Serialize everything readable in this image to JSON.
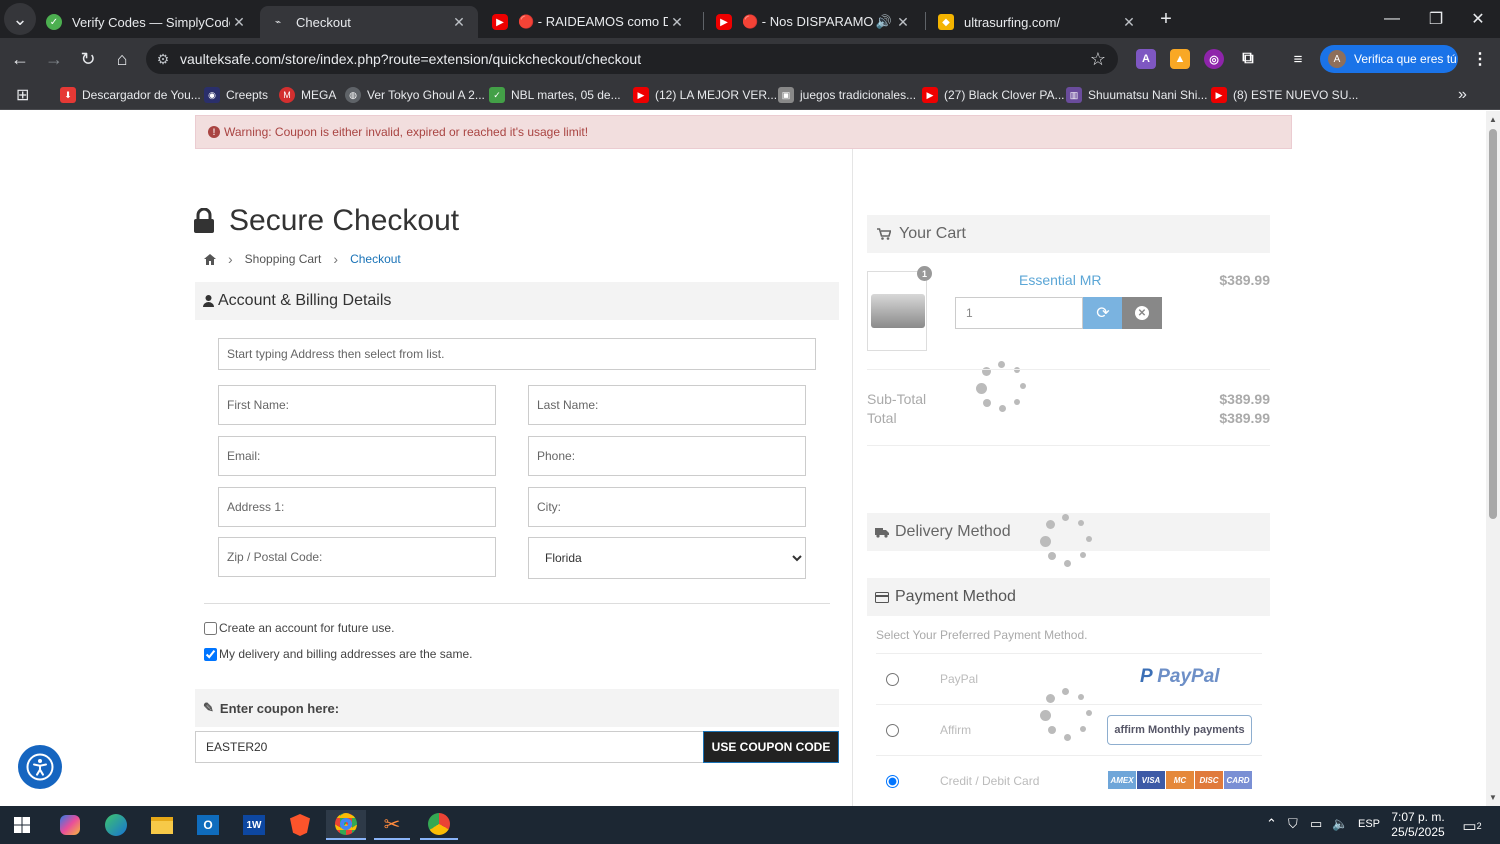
{
  "browser": {
    "tabs": [
      {
        "title": "Verify Codes — SimplyCodes",
        "favicon": "simplycodes-icon",
        "active": false
      },
      {
        "title": "Checkout",
        "favicon": "checkout-icon",
        "active": true
      },
      {
        "title": "🔴 - RAIDEAMOS como DIOSES",
        "favicon": "youtube-icon",
        "active": false
      },
      {
        "title": "🔴 - Nos DISPARAMOS desde",
        "favicon": "youtube-icon",
        "active": false
      },
      {
        "title": "ultrasurfing.com/",
        "favicon": "site-icon",
        "active": false
      }
    ],
    "url": "vaulteksafe.com/store/index.php?route=extension/quickcheckout/checkout",
    "profile_label": "Verifica que eres tú",
    "profile_initial": "A",
    "bookmarks": [
      {
        "label": "Descargador de You...",
        "color": "#e53935",
        "glyph": "⬇"
      },
      {
        "label": "Creepts",
        "color": "#2a2f6b",
        "glyph": "◉"
      },
      {
        "label": "MEGA",
        "color": "#d32f2f",
        "glyph": "M"
      },
      {
        "label": "Ver Tokyo Ghoul A 2...",
        "color": "#444",
        "glyph": "◍"
      },
      {
        "label": "NBL martes, 05 de...",
        "color": "#43a047",
        "glyph": "✓"
      },
      {
        "label": "(12) LA MEJOR VER...",
        "color": "#e00",
        "glyph": "▶"
      },
      {
        "label": "juegos tradicionales...",
        "color": "#888",
        "glyph": "▣"
      },
      {
        "label": "(27) Black Clover PA...",
        "color": "#e00",
        "glyph": "▶"
      },
      {
        "label": "Shuumatsu Nani Shi...",
        "color": "#6a4c9c",
        "glyph": "▥"
      },
      {
        "label": "(8) ESTE NUEVO SU...",
        "color": "#e00",
        "glyph": "▶"
      }
    ]
  },
  "page": {
    "warning": "Warning: Coupon is either invalid, expired or reached it's usage limit!",
    "title": "Secure Checkout",
    "breadcrumb": {
      "home": "home-icon",
      "cart": "Shopping Cart",
      "current": "Checkout"
    },
    "billing": {
      "heading": "Account & Billing Details",
      "address_search_placeholder": "Start typing Address then select from list.",
      "first_name": "First Name:",
      "last_name": "Last Name:",
      "email": "Email:",
      "phone": "Phone:",
      "address1": "Address 1:",
      "city": "City:",
      "zip": "Zip / Postal Code:",
      "state": "Florida",
      "create_account": "Create an account for future use.",
      "same_address": "My delivery and billing addresses are the same."
    },
    "coupon": {
      "heading": "Enter coupon here:",
      "value": "EASTER20",
      "button": "USE COUPON CODE"
    },
    "cart": {
      "heading": "Your Cart",
      "badge": "1",
      "product_name": "Essential MR",
      "product_price": "$389.99",
      "qty": "1",
      "subtotal_label": "Sub-Total",
      "subtotal": "$389.99",
      "total_label": "Total",
      "total": "$389.99"
    },
    "delivery": {
      "heading": "Delivery Method"
    },
    "payment": {
      "heading": "Payment Method",
      "subheading": "Select Your Preferred Payment Method.",
      "options": [
        {
          "label": "PayPal",
          "logo": "PayPal",
          "selected": false
        },
        {
          "label": "Affirm",
          "logo": "affirm Monthly payments",
          "selected": false
        },
        {
          "label": "Credit / Debit Card",
          "logo": "card-logos",
          "selected": true
        }
      ],
      "card_brands": [
        "AMEX",
        "VISA",
        "MC",
        "DISC",
        "CARD"
      ]
    }
  },
  "taskbar": {
    "language": "ESP",
    "time": "7:07 p. m.",
    "date": "25/5/2025",
    "notifications": "2"
  }
}
